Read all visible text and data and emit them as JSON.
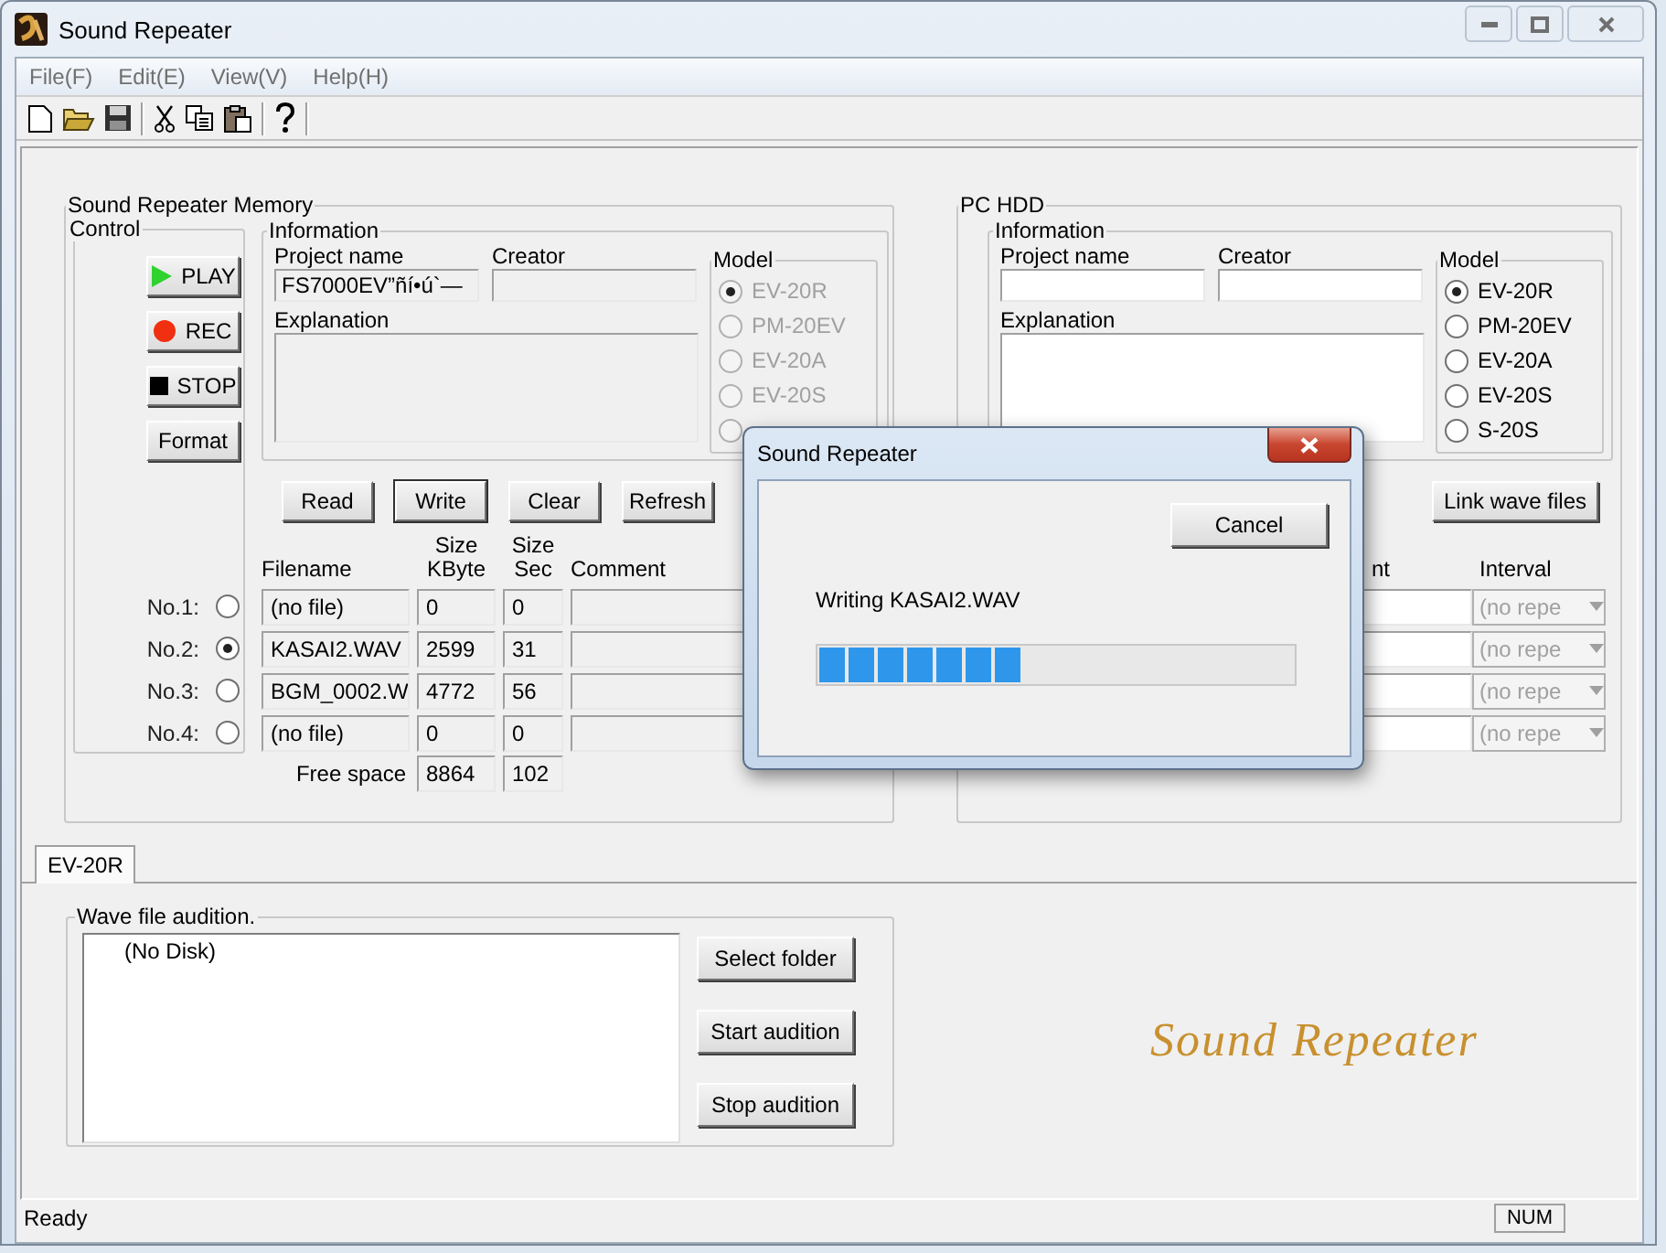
{
  "window": {
    "title": "Sound Repeater"
  },
  "menu": [
    "File(F)",
    "Edit(E)",
    "View(V)",
    "Help(H)"
  ],
  "memory": {
    "title": "Sound Repeater Memory",
    "readonly": true,
    "control": {
      "title": "Control",
      "buttons": [
        {
          "kind": "play",
          "label": "PLAY"
        },
        {
          "kind": "rec",
          "label": "REC"
        },
        {
          "kind": "stop",
          "label": "STOP"
        },
        {
          "kind": "plain",
          "label": "Format"
        }
      ]
    },
    "information": {
      "title": "Information",
      "project_label": "Project name",
      "project_value": "FS7000EV”ñí•ú`—",
      "creator_label": "Creator",
      "explanation_label": "Explanation"
    },
    "model": {
      "title": "Model",
      "disabled": true,
      "options": [
        {
          "label": "EV-20R",
          "selected": true
        },
        {
          "label": "PM-20EV",
          "selected": false
        },
        {
          "label": "EV-20A",
          "selected": false
        },
        {
          "label": "EV-20S",
          "selected": false
        },
        {
          "selected": false
        }
      ]
    },
    "actions": [
      {
        "label": "Read",
        "focused": false
      },
      {
        "label": "Write",
        "focused": true
      },
      {
        "label": "Clear",
        "focused": false
      },
      {
        "label": "Refresh",
        "focused": false
      }
    ],
    "columns": [
      "Filename",
      "Size\nKByte",
      "Size\nSec",
      "Comment"
    ],
    "slots": [
      {
        "label": "No.1:",
        "selected": false,
        "filename": "(no file)",
        "size_kbyte": "0",
        "size_sec": "0"
      },
      {
        "label": "No.2:",
        "selected": true,
        "filename": "KASAI2.WAV",
        "size_kbyte": "2599",
        "size_sec": "31"
      },
      {
        "label": "No.3:",
        "selected": false,
        "filename": "BGM_0002.W",
        "size_kbyte": "4772",
        "size_sec": "56"
      },
      {
        "label": "No.4:",
        "selected": false,
        "filename": "(no file)",
        "size_kbyte": "0",
        "size_sec": "0"
      }
    ],
    "free_space": {
      "label": "Free space",
      "kbyte": "8864",
      "sec": "102"
    }
  },
  "pc_hdd": {
    "title": "PC HDD",
    "readonly": false,
    "information": {
      "title": "Information",
      "project_label": "Project name",
      "creator_label": "Creator",
      "explanation_label": "Explanation"
    },
    "model": {
      "title": "Model",
      "disabled": false,
      "options": [
        {
          "label": "EV-20R",
          "selected": true
        },
        {
          "label": "PM-20EV",
          "selected": false
        },
        {
          "label": "EV-20A",
          "selected": false
        },
        {
          "label": "EV-20S",
          "selected": false
        },
        {
          "label": "S-20S",
          "selected": false
        }
      ]
    },
    "actions": [
      {
        "label": "Link wave files",
        "focused": false
      }
    ],
    "columns": [
      "nt",
      "Interval"
    ],
    "slots": [
      {
        "interval": "(no repe",
        "disabled": true
      },
      {
        "interval": "(no repe",
        "disabled": true
      },
      {
        "interval": "(no repe",
        "disabled": true
      },
      {
        "interval": "(no repe",
        "disabled": true
      }
    ]
  },
  "tabs": [
    {
      "label": "EV-20R",
      "selected": true
    }
  ],
  "audition": {
    "title": "Wave file audition.",
    "items": [
      "(No Disk)"
    ],
    "buttons": [
      "Select folder",
      "Start audition",
      "Stop audition"
    ]
  },
  "logo": "Sound Repeater",
  "status_bar": {
    "text": "Ready",
    "indicators": [
      "NUM"
    ]
  },
  "dialog": {
    "title": "Sound Repeater",
    "cancel": "Cancel",
    "message": "Writing KASAI2.WAV",
    "level": 0.43
  }
}
